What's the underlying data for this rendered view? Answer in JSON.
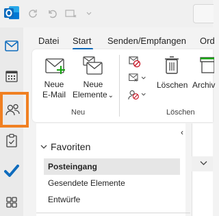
{
  "tabs": [
    {
      "label": "Datei"
    },
    {
      "label": "Start"
    },
    {
      "label": "Senden/Empfangen"
    },
    {
      "label": "Ord"
    }
  ],
  "ribbon": {
    "new_email_line1": "Neue",
    "new_email_line2": "E-Mail",
    "new_items_line1": "Neue",
    "new_items_line2": "Elemente",
    "new_items_chevron": "⌄",
    "group_new": "Neu",
    "delete_label": "Löschen",
    "archive_label": "Archiv",
    "group_delete": "Löschen"
  },
  "folder_pane": {
    "collapse_glyph": "‹",
    "favorites_label": "Favoriten",
    "items": [
      {
        "label": "Posteingang"
      },
      {
        "label": "Gesendete Elemente"
      },
      {
        "label": "Entwürfe"
      }
    ]
  },
  "colors": {
    "accent": "#0f6cbd",
    "highlight": "#f08022",
    "todo_check": "#0f6cbd"
  },
  "icons": [
    "outlook-logo-icon",
    "sync-icon",
    "undo-icon",
    "quick-steps-icon",
    "mail-icon",
    "calendar-icon",
    "people-icon",
    "todo-icon",
    "check-icon",
    "apps-icon"
  ]
}
